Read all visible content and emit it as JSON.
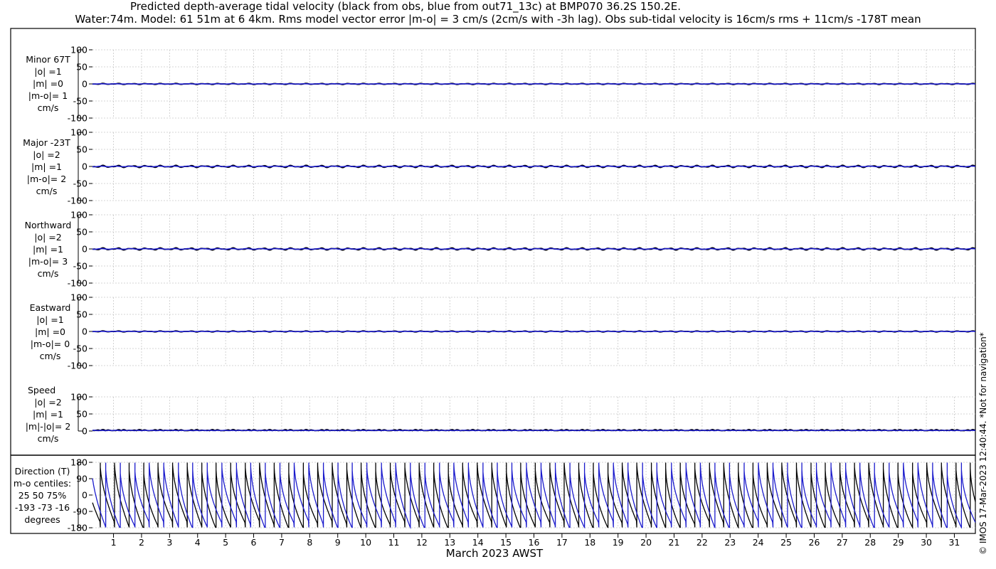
{
  "title_line1": "Predicted depth-average tidal velocity (black from obs, blue from out71_13c) at BMP070 36.2S 150.2E.",
  "title_line2": "Water:74m. Model: 61 51m at 6 4km. Rms model vector error |m-o| = 3 cm/s (2cm/s with -3h lag). Obs sub-tidal velocity is 16cm/s rms + 11cm/s -178T mean",
  "xlabel": "March 2023 AWST",
  "side_text": "© IMOS 17-Mar-2023 12:40:44. *Not for navigation*",
  "panels": [
    {
      "lines": [
        "Minor 67T",
        "|o| =1",
        "|m| =0",
        "|m-o|= 1",
        "cm/s"
      ]
    },
    {
      "lines": [
        "Major -23T",
        "|o| =2",
        "|m| =1",
        "|m-o|= 2",
        "cm/s"
      ]
    },
    {
      "lines": [
        "Northward",
        "|o| =2",
        "|m| =1",
        "|m-o|= 3",
        "cm/s"
      ]
    },
    {
      "lines": [
        "Eastward",
        "|o| =1",
        "|m| =0",
        "|m-o|= 0",
        "cm/s"
      ]
    },
    {
      "lines": [
        "Speed",
        "|o| =2",
        "|m| =1",
        "|m|-|o|= 2",
        "cm/s"
      ]
    },
    {
      "lines": [
        "Direction (T)",
        "m-o centiles:",
        "25  50  75%",
        "-193  -73  -16",
        "degrees"
      ]
    }
  ],
  "colors": {
    "obs": "#000000",
    "model": "#1a1acc",
    "grid": "#c8c8c8"
  },
  "chart_data": [
    {
      "type": "line",
      "name": "Minor 67T",
      "ylim": [
        -100,
        100
      ],
      "yticks": [
        100,
        50,
        0,
        -50,
        -100
      ],
      "xlim": [
        0.25,
        31.75
      ],
      "xticks": [
        1,
        2,
        3,
        4,
        5,
        6,
        7,
        8,
        9,
        10,
        11,
        12,
        13,
        14,
        15,
        16,
        17,
        18,
        19,
        20,
        21,
        22,
        23,
        24,
        25,
        26,
        27,
        28,
        29,
        30,
        31
      ],
      "amp_obs": 1,
      "amp_model": 0
    },
    {
      "type": "line",
      "name": "Major -23T",
      "ylim": [
        -100,
        100
      ],
      "yticks": [
        100,
        50,
        0,
        -50,
        -100
      ],
      "xlim": [
        0.25,
        31.75
      ],
      "amp_obs": 2,
      "amp_model": 1
    },
    {
      "type": "line",
      "name": "Northward",
      "ylim": [
        -100,
        100
      ],
      "yticks": [
        100,
        50,
        0,
        -50,
        -100
      ],
      "xlim": [
        0.25,
        31.75
      ],
      "amp_obs": 2,
      "amp_model": 1
    },
    {
      "type": "line",
      "name": "Eastward",
      "ylim": [
        -100,
        100
      ],
      "yticks": [
        100,
        50,
        0,
        -50,
        -100
      ],
      "xlim": [
        0.25,
        31.75
      ],
      "amp_obs": 1,
      "amp_model": 0
    },
    {
      "type": "line",
      "name": "Speed",
      "ylim": [
        0,
        100
      ],
      "yticks": [
        100,
        50,
        0
      ],
      "xlim": [
        0.25,
        31.75
      ],
      "amp_obs": 2,
      "amp_model": 1
    },
    {
      "type": "line",
      "name": "Direction (T)",
      "ylim": [
        -180,
        180
      ],
      "yticks": [
        180,
        90,
        0,
        -90,
        -180
      ],
      "xlim": [
        0.25,
        31.75
      ],
      "tidal_period_days": 0.5175,
      "model_lag_days": 0.2
    }
  ]
}
